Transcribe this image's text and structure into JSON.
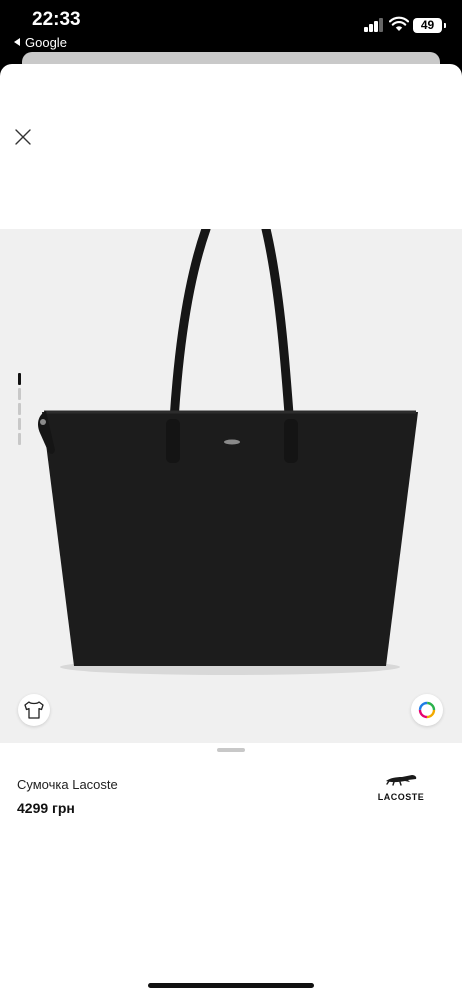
{
  "status_bar": {
    "time": "22:33",
    "back_app": "Google",
    "battery": "49"
  },
  "product": {
    "title": "Сумочка Lacoste",
    "price": "4299 грн",
    "brand_logo_text": "LACOSTE"
  },
  "gallery": {
    "image_count": 6,
    "active_index": 0,
    "left_button_icon": "tshirt-icon",
    "right_button_icon": "color-ring-icon"
  },
  "colors": {
    "background": "#ffffff",
    "gallery_bg": "#f0f0f0",
    "bag": "#1c1c1c",
    "text": "#111111"
  }
}
